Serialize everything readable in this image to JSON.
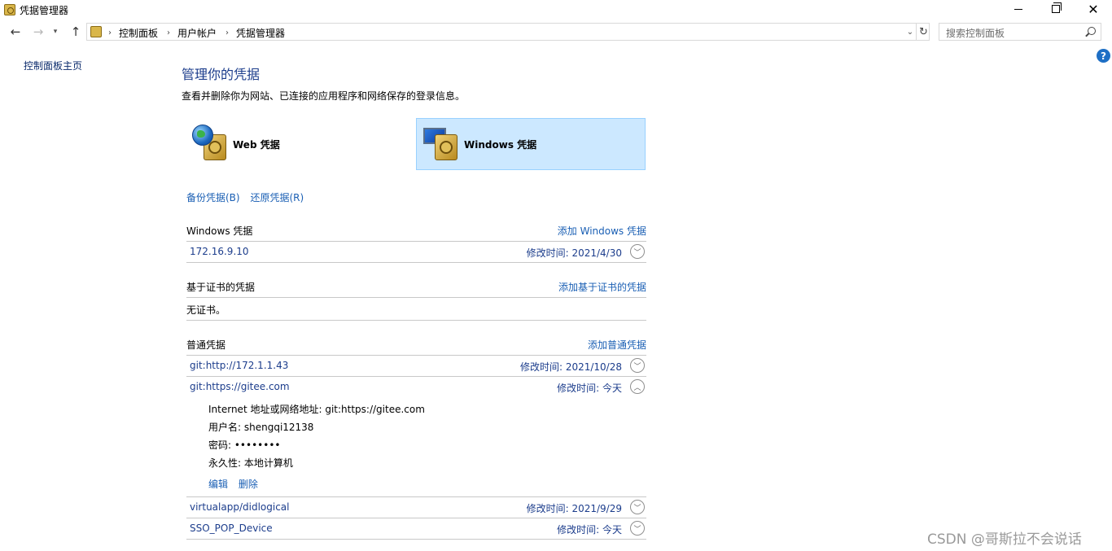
{
  "window": {
    "title": "凭据管理器"
  },
  "breadcrumb": [
    "控制面板",
    "用户帐户",
    "凭据管理器"
  ],
  "search": {
    "placeholder": "搜索控制面板"
  },
  "leftnav": {
    "home": "控制面板主页"
  },
  "main": {
    "title": "管理你的凭据",
    "description": "查看并删除你为网站、已连接的应用程序和网络保存的登录信息。",
    "types": [
      {
        "label": "Web 凭据",
        "icon": "globe-vault-icon",
        "selected": false
      },
      {
        "label": "Windows 凭据",
        "icon": "monitor-vault-icon",
        "selected": true
      }
    ],
    "backup_label": "备份凭据(B)",
    "restore_label": "还原凭据(R)"
  },
  "windows_creds": {
    "title": "Windows 凭据",
    "add_label": "添加 Windows 凭据",
    "items": [
      {
        "name": "172.16.9.10",
        "modified": "修改时间:  2021/4/30"
      }
    ]
  },
  "cert_creds": {
    "title": "基于证书的凭据",
    "add_label": "添加基于证书的凭据",
    "empty": "无证书。"
  },
  "generic_creds": {
    "title": "普通凭据",
    "add_label": "添加普通凭据",
    "items": [
      {
        "name": "git:http://172.1.1.43",
        "modified": "修改时间:  2021/10/28"
      },
      {
        "name": "git:https://gitee.com",
        "modified": "修改时间:  今天"
      },
      {
        "name": "virtualapp/didlogical",
        "modified": "修改时间:  2021/9/29"
      },
      {
        "name": "SSO_POP_Device",
        "modified": "修改时间:  今天"
      }
    ],
    "expanded": {
      "address": "Internet 地址或网络地址:  git:https://gitee.com",
      "username": "用户名:  shengqi12138",
      "password": "密码:  ••••••••",
      "persistence": "永久性:  本地计算机",
      "edit_label": "编辑",
      "delete_label": "删除"
    }
  },
  "watermark": "CSDN @哥斯拉不会说话"
}
